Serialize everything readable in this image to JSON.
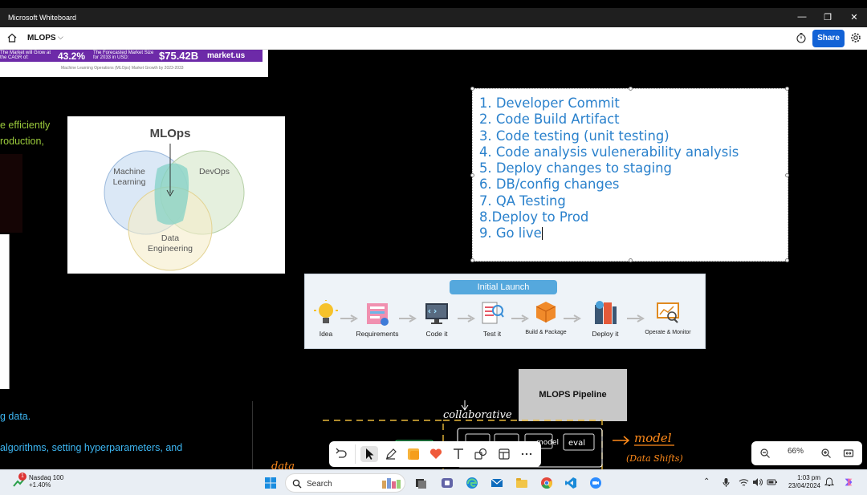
{
  "window": {
    "title": "Microsoft Whiteboard",
    "minimize": "—",
    "restore": "❐",
    "close": "✕"
  },
  "appbar": {
    "board_name": "MLOPS",
    "share_label": "Share"
  },
  "market_banner": {
    "growth_label": "The Market will Grow at the CAGR of:",
    "cagr": "43.2%",
    "forecast_label": "The Forecasted Market Size for 2033 in USD:",
    "forecast_value": "$75.42B",
    "brand": "market.us",
    "caption": "Machine Learning Operations (MLOps) Market Growth by 2023-2033"
  },
  "left_text": {
    "line1": "e efficiently",
    "line2": "roduction,",
    "line3": "g data.",
    "line4": "algorithms, setting hyperparameters, and"
  },
  "venn": {
    "title": "MLOps",
    "set_a": [
      "Machine",
      "Learning"
    ],
    "set_b": "DevOps",
    "set_c": [
      "Data",
      "Engineering"
    ]
  },
  "steps": [
    "1. Developer Commit",
    "2. Code Build Artifact",
    "3. Code testing (unit testing)",
    "4. Code analysis vulenerability analysis",
    "5. Deploy changes to staging",
    "6. DB/config changes",
    "7. QA Testing",
    "8.Deploy to Prod",
    "9. Go live"
  ],
  "pipeline": {
    "banner": "Initial Launch",
    "stages": [
      {
        "label": "Idea",
        "icon": "lightbulb-icon"
      },
      {
        "label": "Requirements",
        "icon": "requirements-icon"
      },
      {
        "label": "Code it",
        "icon": "monitor-code-icon"
      },
      {
        "label": "Test it",
        "icon": "test-checklist-icon"
      },
      {
        "label": "Build & Package",
        "icon": "package-icon"
      },
      {
        "label": "Deploy it",
        "icon": "server-deploy-icon"
      },
      {
        "label": "Operate & Monitor",
        "icon": "monitor-chart-icon"
      }
    ]
  },
  "mlops_box": {
    "label": "MLOPS Pipeline"
  },
  "sketch": {
    "collab": "collaborative",
    "model": "model",
    "data_shifts": "(Data Shifts)",
    "eval": "eval",
    "model_box": "model",
    "data": "data"
  },
  "toolbar": {
    "tools": [
      "undo-icon",
      "select-pointer-icon",
      "pen-icon",
      "sticky-note-icon",
      "reaction-heart-icon",
      "text-icon",
      "shapes-icon",
      "templates-icon",
      "more-icon"
    ]
  },
  "zoom": {
    "level": "66%",
    "zoom_out": "zoom-out-icon",
    "zoom_in": "zoom-in-icon",
    "fit": "fit-screen-icon"
  },
  "taskbar": {
    "ticker_name": "Nasdaq 100",
    "ticker_change": "+1.40%",
    "ticker_badge": "1",
    "search_placeholder": "Search",
    "time": "1:03 pm",
    "date": "23/04/2024"
  },
  "colors": {
    "share": "#1262d6",
    "steps_text": "#2a81cc",
    "green_text": "#9ccc3c",
    "blue_text": "#3db6f2",
    "banner": "#55a8dd"
  }
}
